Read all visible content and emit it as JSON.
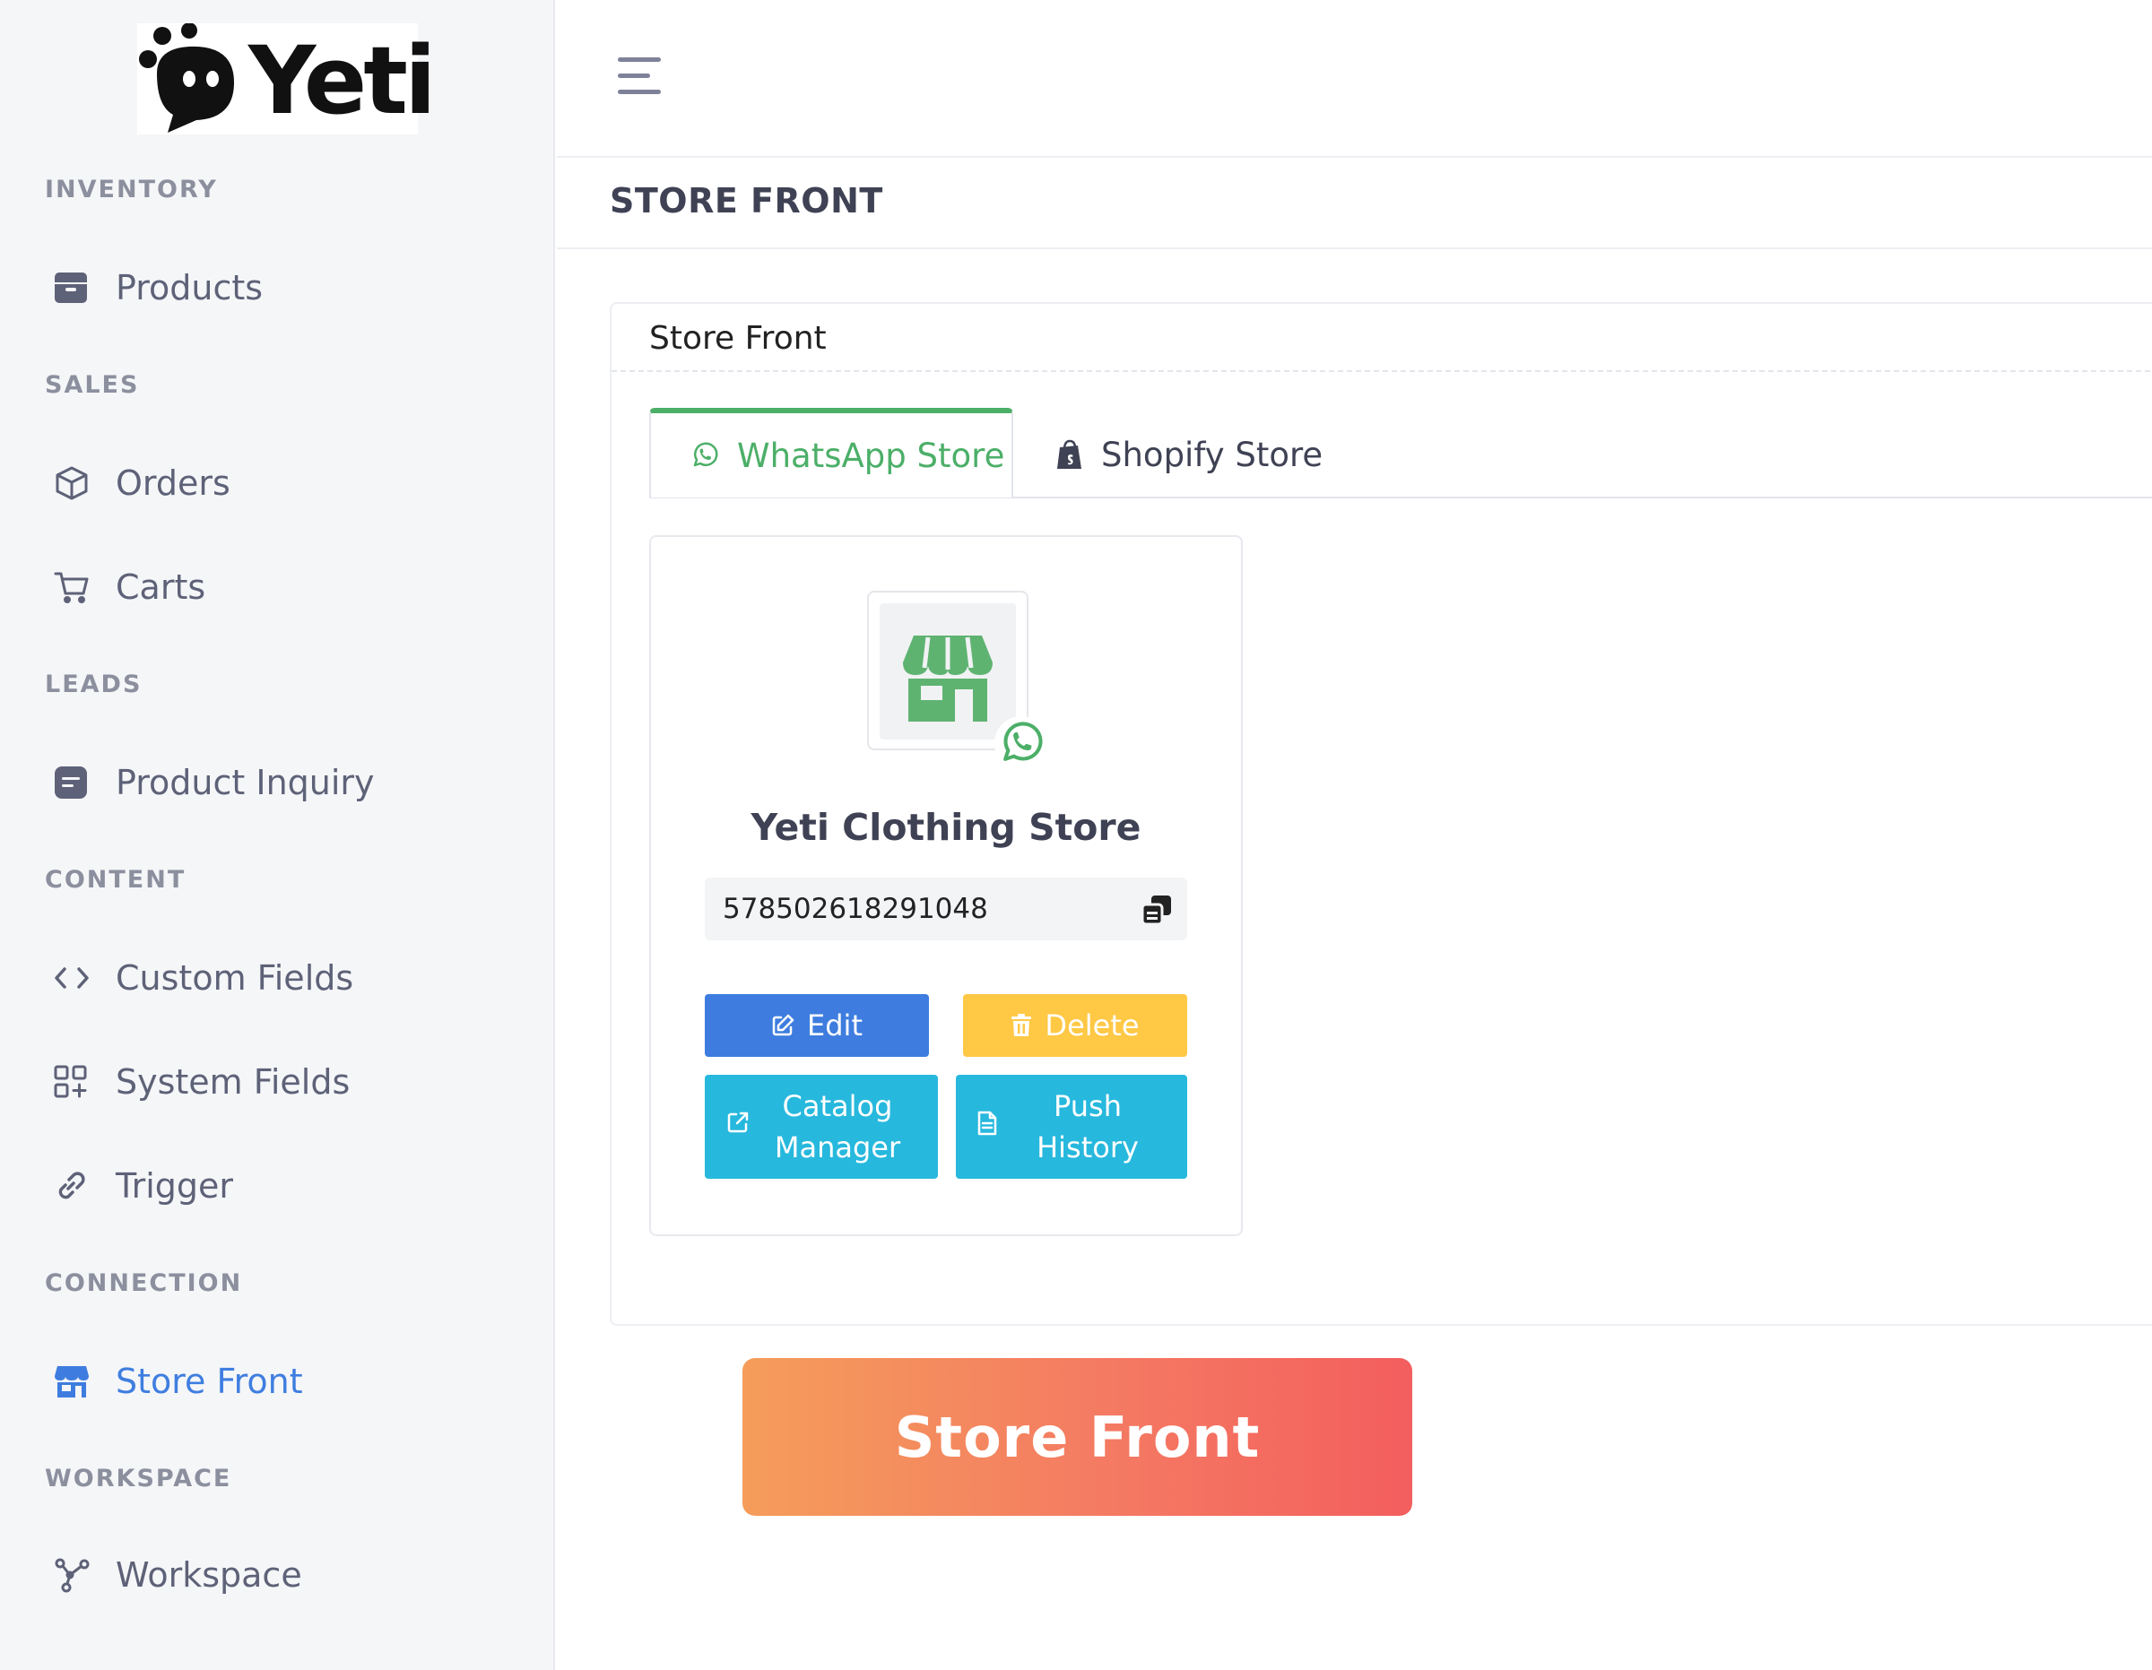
{
  "brand": {
    "name": "Yeti"
  },
  "sidebar": {
    "sections": [
      {
        "label": "INVENTORY"
      },
      {
        "label": "SALES"
      },
      {
        "label": "LEADS"
      },
      {
        "label": "CONTENT"
      },
      {
        "label": "CONNECTION"
      },
      {
        "label": "WORKSPACE"
      }
    ],
    "items": [
      {
        "label": "Products",
        "icon": "archive-icon"
      },
      {
        "label": "Orders",
        "icon": "box-icon"
      },
      {
        "label": "Carts",
        "icon": "cart-icon"
      },
      {
        "label": "Product Inquiry",
        "icon": "note-icon"
      },
      {
        "label": "Custom Fields",
        "icon": "code-icon"
      },
      {
        "label": "System Fields",
        "icon": "grid-plus-icon"
      },
      {
        "label": "Trigger",
        "icon": "link-icon"
      },
      {
        "label": "Store Front",
        "icon": "store-icon",
        "active": true
      },
      {
        "label": "Workspace",
        "icon": "nodes-icon"
      }
    ]
  },
  "header": {
    "menu_icon": "hamburger-icon"
  },
  "subheader": {
    "title": "STORE FRONT"
  },
  "card": {
    "title": "Store Front",
    "tabs": [
      {
        "label": "WhatsApp Store",
        "icon": "whatsapp-icon",
        "active": true
      },
      {
        "label": "Shopify Store",
        "icon": "shopify-bag-icon",
        "active": false
      }
    ],
    "store": {
      "name": "Yeti Clothing Store",
      "id": "578502618291048",
      "buttons": {
        "edit": "Edit",
        "delete": "Delete",
        "catalog_line1": "Catalog",
        "catalog_line2": "Manager",
        "push_line1": "Push",
        "push_line2": "History"
      }
    }
  },
  "banner": {
    "text": "Store Front"
  },
  "colors": {
    "accent_blue": "#3e7ddf",
    "whatsapp_green": "#4caf68",
    "warning_yellow": "#ffc845",
    "info_cyan": "#27b8dd",
    "banner_start": "#f59d5b",
    "banner_end": "#f35e5e"
  }
}
